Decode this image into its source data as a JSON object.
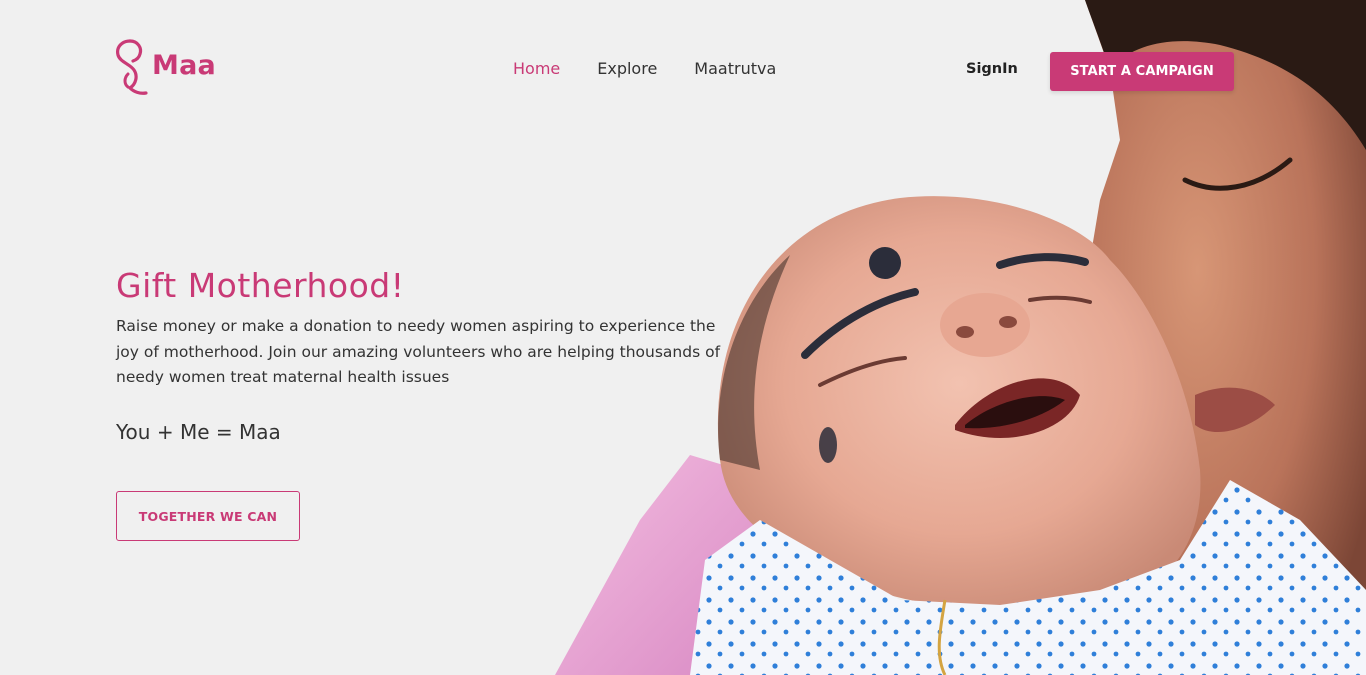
{
  "brand": {
    "name": "Maa",
    "accent_color": "#c93a76"
  },
  "nav": {
    "items": [
      {
        "label": "Home",
        "active": true
      },
      {
        "label": "Explore",
        "active": false
      },
      {
        "label": "Maatrutva",
        "active": false
      }
    ]
  },
  "header": {
    "signin_label": "SignIn",
    "cta_label": "START A CAMPAIGN"
  },
  "hero": {
    "title": "Gift Motherhood!",
    "description": "Raise money or make a donation to needy women aspiring to experience the joy of motherhood. Join our amazing volunteers who are helping thousands of needy women treat maternal health issues",
    "equation": "You + Me = Maa",
    "button_label": "TOGETHER WE CAN"
  }
}
